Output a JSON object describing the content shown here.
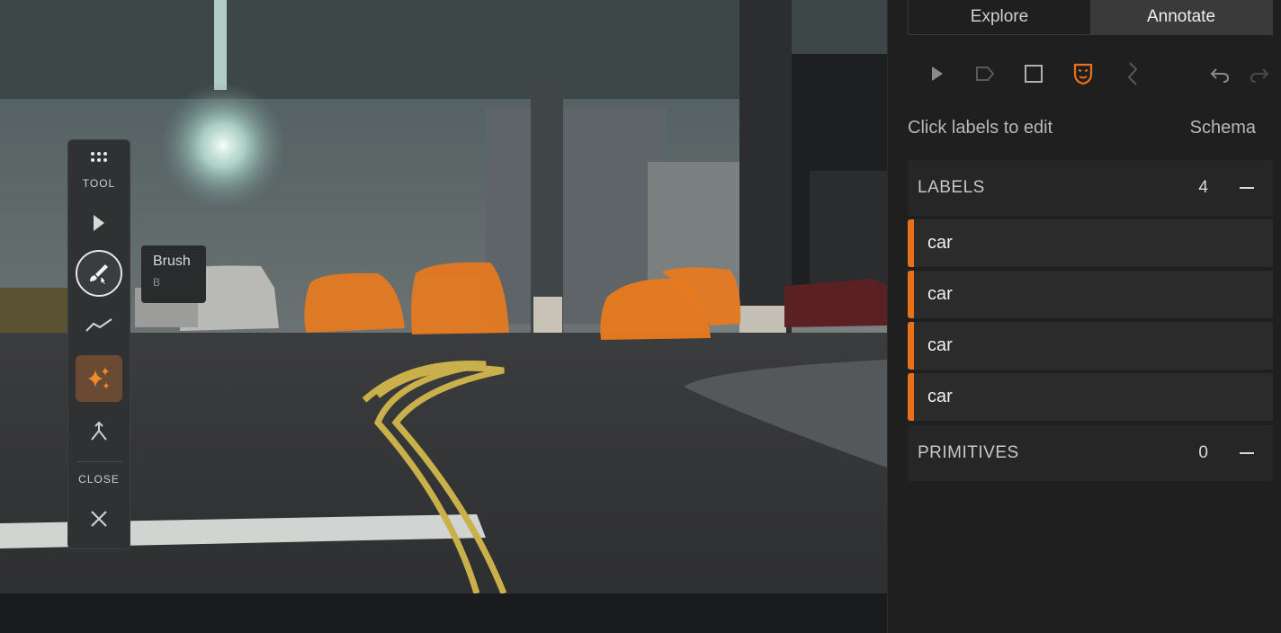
{
  "toolbar": {
    "tool_label": "TOOL",
    "close_label": "CLOSE",
    "tooltip": {
      "title": "Brush",
      "shortcut": "B"
    }
  },
  "panel": {
    "tabs": [
      {
        "label": "Explore",
        "active": false
      },
      {
        "label": "Annotate",
        "active": true
      }
    ],
    "hint": "Click labels to edit",
    "schema_link": "Schema",
    "labels_section": {
      "title": "LABELS",
      "count": "4"
    },
    "labels": [
      {
        "name": "car",
        "color": "#e8711a"
      },
      {
        "name": "car",
        "color": "#e8711a"
      },
      {
        "name": "car",
        "color": "#e8711a"
      },
      {
        "name": "car",
        "color": "#e8711a"
      }
    ],
    "primitives_section": {
      "title": "PRIMITIVES",
      "count": "0"
    }
  },
  "colors": {
    "accent": "#e8711a",
    "mask": "#e87a1e"
  }
}
